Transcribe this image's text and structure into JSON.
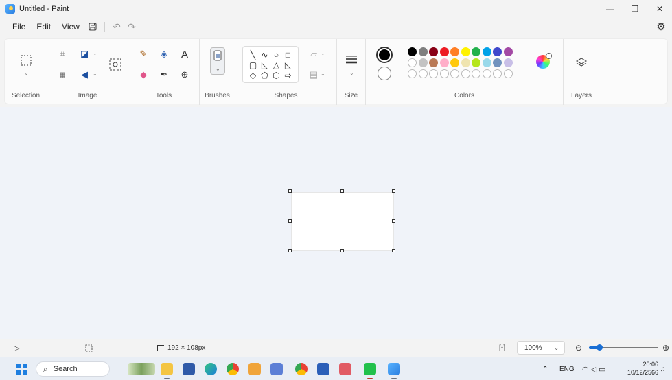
{
  "window": {
    "title": "Untitled - Paint",
    "minimize_icon": "minimize-icon",
    "maximize_icon": "restore-icon",
    "close_icon": "close-icon"
  },
  "menu": {
    "file": "File",
    "edit": "Edit",
    "view": "View",
    "save_icon": "save-icon",
    "undo_icon": "undo-icon",
    "redo_icon": "redo-icon",
    "settings_icon": "gear-icon"
  },
  "ribbon": {
    "groups": {
      "selection": "Selection",
      "image": "Image",
      "tools": "Tools",
      "brushes": "Brushes",
      "shapes": "Shapes",
      "size": "Size",
      "colors": "Colors",
      "layers": "Layers"
    },
    "tools_text_glyph": "A",
    "shape_glyphs": [
      "╲",
      "∿",
      "○",
      "□",
      "▢",
      "◺",
      "△",
      "◺",
      "◇",
      "⬠",
      "⬡",
      "⇨"
    ],
    "colors": {
      "primary": "#000000",
      "secondary": "#ffffff",
      "row1": [
        "#000000",
        "#7f7f7f",
        "#880015",
        "#ed1c24",
        "#ff7f27",
        "#fff200",
        "#22b14c",
        "#00a2e8",
        "#3f48cc",
        "#a349a4"
      ],
      "row2": [
        "#ffffff",
        "#c3c3c3",
        "#b97a57",
        "#ffaec9",
        "#ffc90e",
        "#efe4b0",
        "#b5e61d",
        "#99d9ea",
        "#7092be",
        "#c8bfe7"
      ],
      "row3_empty_count": 10
    }
  },
  "canvas": {
    "background": "#ffffff"
  },
  "status": {
    "pointer_icon": "pointer-icon",
    "selection_icon": "selection-size-icon",
    "canvas_size": "192 × 108px",
    "zoom": "100%",
    "zoom_level_fraction": 0.15,
    "fit_icon": "fit-to-window-icon",
    "zoom_out_icon": "zoom-out-icon",
    "zoom_in_icon": "zoom-in-icon"
  },
  "taskbar": {
    "search_placeholder": "Search",
    "lang": "ENG",
    "time": "20:06",
    "date": "10/12/2566"
  }
}
